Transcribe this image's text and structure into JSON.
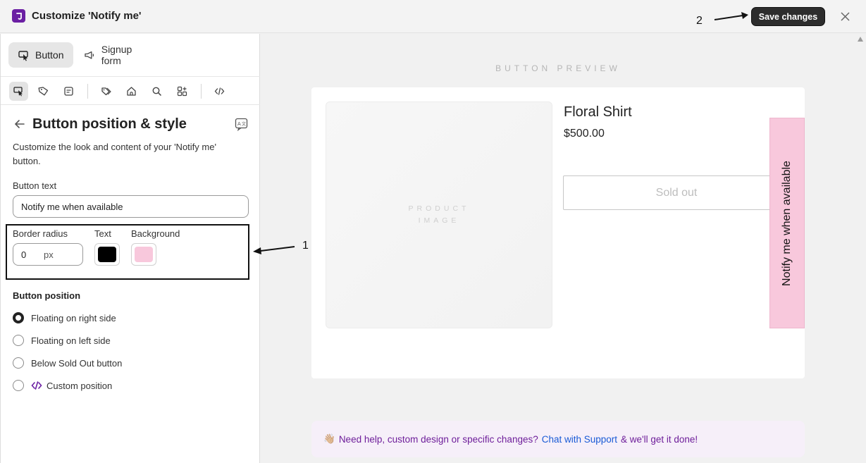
{
  "header": {
    "title": "Customize 'Notify me'",
    "save_label": "Save changes",
    "annotation": "2"
  },
  "tabs": [
    {
      "label": "Button",
      "icon": "cursor-click-icon",
      "active": true
    },
    {
      "label": "Signup form",
      "icon": "megaphone-icon",
      "active": false
    }
  ],
  "toolbar_icons": [
    "cursor-click-icon",
    "tag-icon",
    "form-icon",
    "tags-icon",
    "home-icon",
    "search-icon",
    "grid-plus-icon",
    "code-icon"
  ],
  "section": {
    "title": "Button position & style",
    "description": "Customize the look and content of your 'Notify me' button."
  },
  "fields": {
    "button_text_label": "Button text",
    "button_text_value": "Notify me when available",
    "border_radius_label": "Border radius",
    "border_radius_value": "0",
    "border_radius_unit": "px",
    "text_label": "Text",
    "text_color": "#000000",
    "background_label": "Background",
    "background_color": "#f8c8dc",
    "annotation": "1"
  },
  "position": {
    "title": "Button position",
    "options": [
      {
        "label": "Floating on right side",
        "checked": true
      },
      {
        "label": "Floating on left side",
        "checked": false
      },
      {
        "label": "Below Sold Out button",
        "checked": false
      },
      {
        "label": "Custom position",
        "checked": false
      }
    ]
  },
  "preview": {
    "label": "BUTTON PREVIEW",
    "image_placeholder": "PRODUCT IMAGE",
    "product_name": "Floral Shirt",
    "price": "$500.00",
    "soldout_label": "Sold out",
    "notify_label": "Notify me when available"
  },
  "help": {
    "emoji": "👋🏼",
    "text_before": "Need help, custom design or specific changes?",
    "link": "Chat with Support",
    "text_after": "& we'll get it done!"
  },
  "colors": {
    "brand": "#6b1fa3",
    "save_bg": "#2d2d2d",
    "link": "#1a5bd6"
  }
}
